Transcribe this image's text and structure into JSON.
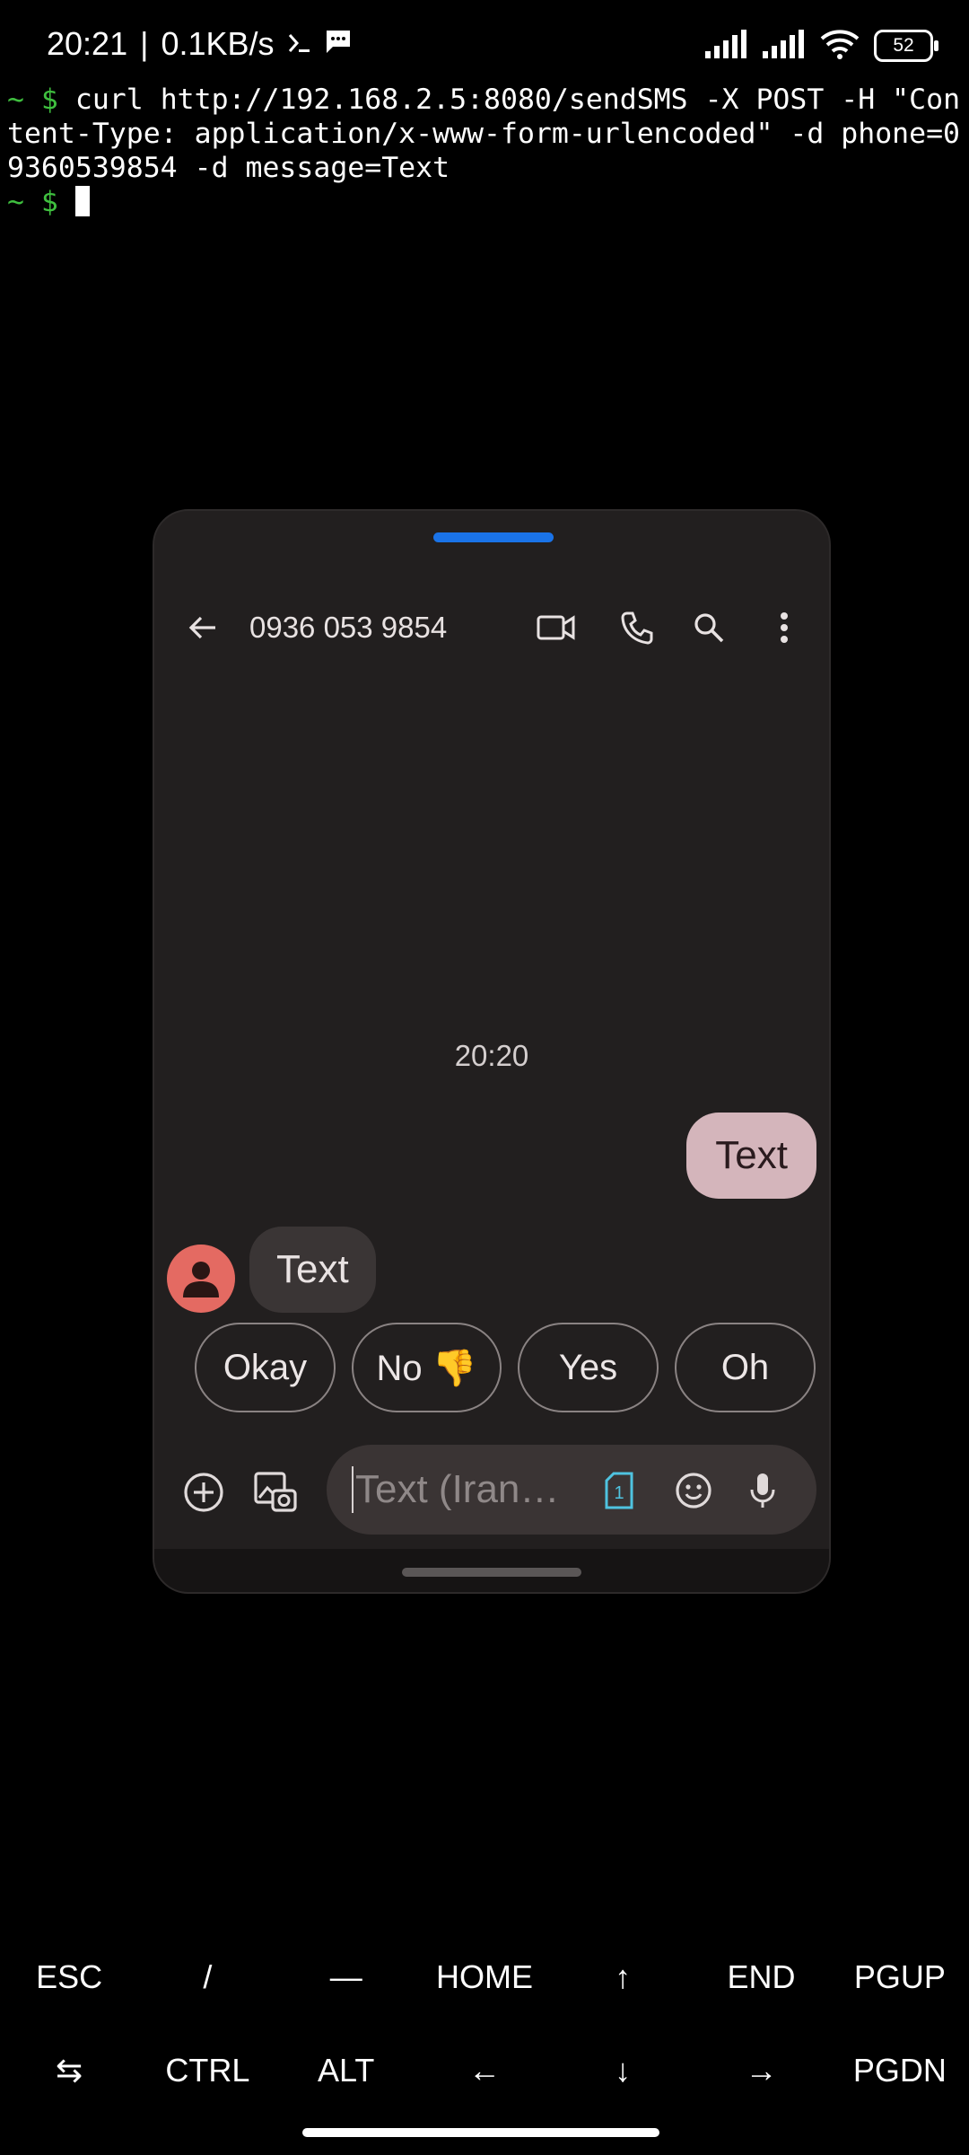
{
  "status_bar": {
    "time": "20:21",
    "separator": "|",
    "net_speed": "0.1KB/s",
    "battery": "52"
  },
  "terminal": {
    "prompt": "~ $",
    "command": "curl http://192.168.2.5:8080/sendSMS -X POST -H \"Content-Type: application/x-www-form-urlencoded\" -d phone=09360539854 -d message=Text",
    "prompt2": "~ $"
  },
  "phone": {
    "contact": "0936 053 9854",
    "timestamp": "20:20",
    "outgoing_message": "Text",
    "incoming_message": "Text",
    "smart_replies": [
      "Okay",
      "No 👎",
      "Yes",
      "Oh"
    ],
    "input_placeholder": "Text (Iran…",
    "sim_number": "1"
  },
  "extra_keys": {
    "row1": [
      "ESC",
      "/",
      "—",
      "HOME",
      "↑",
      "END",
      "PGUP"
    ],
    "row2": [
      "⇆",
      "CTRL",
      "ALT",
      "←",
      "↓",
      "→",
      "PGDN"
    ]
  }
}
